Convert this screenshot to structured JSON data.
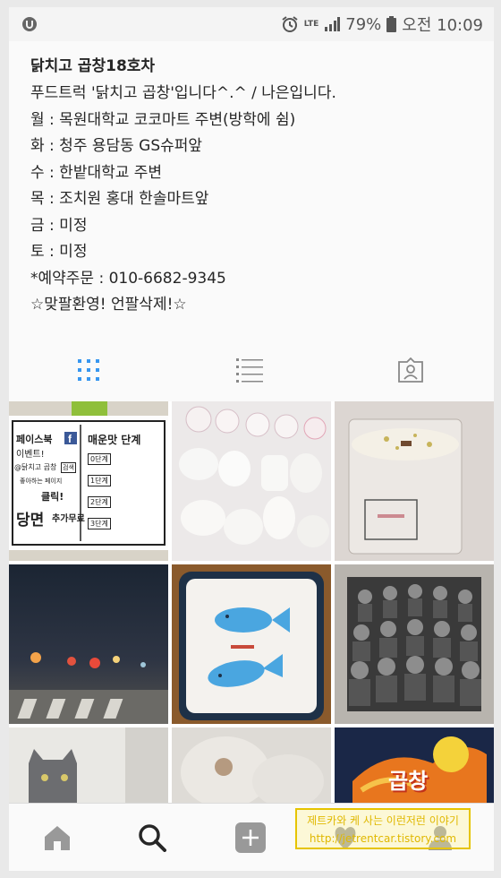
{
  "status_bar": {
    "network": "LTE",
    "battery": "79%",
    "time": "오전 10:09"
  },
  "profile": {
    "name": "닭치고 곱창18호차",
    "bio": [
      "푸드트럭 '닭치고 곱창'입니다^.^ / 나은입니다.",
      "월 : 목원대학교 코코마트 주변(방학에 쉼)",
      "화 : 청주 용담동 GS슈퍼앞",
      "수 : 한밭대학교 주변",
      "목 : 조치원 홍대 한솔마트앞",
      "금 : 미정",
      "토 : 미정",
      "*예약주문 : 010-6682-9345",
      "☆맞팔환영! 언팔삭제!☆"
    ]
  },
  "tabs": [
    "grid-icon",
    "list-icon",
    "tagged-icon"
  ],
  "accent_color": "#3897f0",
  "posts": {
    "p1": {
      "facebook": "페이스북",
      "event": "이벤트!",
      "account": "@닭치고 곱창",
      "search": "검색",
      "like_page": "좋아하는 페이지",
      "click": "클릭!",
      "dangmyeon": "당면",
      "free": "추가무료",
      "spicy_title": "매운맛 단계",
      "levels": [
        "0단계",
        "1단계",
        "2단계",
        "3단계"
      ]
    },
    "p9": {
      "title": "곱창"
    }
  },
  "watermark": {
    "line1": "제트카와 케 사는 이런저런 이야기",
    "line2": "http://jetrentcar.tistory.com"
  }
}
